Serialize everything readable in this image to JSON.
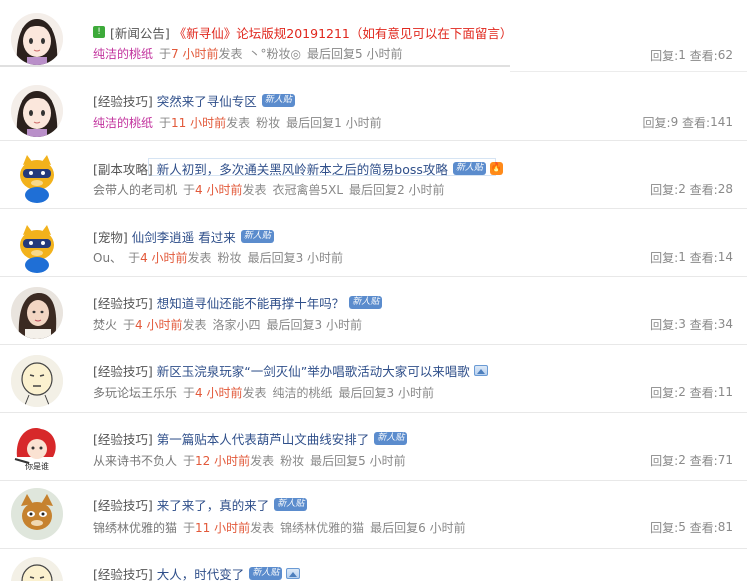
{
  "labels": {
    "prefix": "于",
    "posted": "发表",
    "last_reply": "最后回复",
    "reply": "回复:",
    "view": "查看:"
  },
  "threads": [
    {
      "category": "[新闻公告]",
      "title": "《新寻仙》论坛版规20191211（如有意见可以在下面留言）",
      "author": "纯洁的桃纸",
      "time": "7 小时前",
      "last_replier": "丶°粉妆◎",
      "last_time": "5 小时前",
      "replies": "1",
      "views": "62",
      "avatar": "anime-girl"
    },
    {
      "category": "[经验技巧]",
      "title": "突然来了寻仙专区",
      "badge": "新人贴",
      "author": "纯洁的桃纸",
      "time": "11 小时前",
      "last_replier": "粉妆",
      "last_time": "1 小时前",
      "replies": "9",
      "views": "141",
      "avatar": "anime-girl"
    },
    {
      "category": "[副本攻略]",
      "title": "新人初到，多次通关黑风岭新本之后的简易boss攻略",
      "badge": "新人贴",
      "author": "会带人的老司机",
      "time": "4 小时前",
      "last_replier": "衣冠禽兽5XL",
      "last_time": "2 小时前",
      "replies": "2",
      "views": "28",
      "avatar": "yellow-mascot"
    },
    {
      "category": "[宠物]",
      "title": "仙剑李逍遥 看过来",
      "badge": "新人贴",
      "author": "Ou、",
      "time": "4 小时前",
      "last_replier": "粉妆",
      "last_time": "3 小时前",
      "replies": "1",
      "views": "14",
      "avatar": "yellow-mascot"
    },
    {
      "category": "[经验技巧]",
      "title": "想知道寻仙还能不能再撑十年吗？",
      "badge": "新人贴",
      "author": "焚火",
      "time": "4 小时前",
      "last_replier": "洛家小四",
      "last_time": "3 小时前",
      "replies": "3",
      "views": "34",
      "avatar": "woman-photo"
    },
    {
      "category": "[经验技巧]",
      "title": "新区玉浣泉玩家“一剑灭仙”举办唱歌活动大家可以来唱歌",
      "author": "多玩论坛王乐乐",
      "time": "4 小时前",
      "last_replier": "纯洁的桃纸",
      "last_time": "3 小时前",
      "replies": "2",
      "views": "11",
      "avatar": "smiley-face"
    },
    {
      "category": "[经验技巧]",
      "title": "第一篇贴本人代表葫芦山文曲线安排了",
      "badge": "新人贴",
      "author": "从来诗书不负人",
      "time": "12 小时前",
      "last_replier": "粉妆",
      "last_time": "5 小时前",
      "replies": "2",
      "views": "71",
      "avatar": "red-hair-girl"
    },
    {
      "category": "[经验技巧]",
      "title": "来了来了，真的来了",
      "badge": "新人贴",
      "author": "锦绣林优雅的猫",
      "time": "11 小时前",
      "last_replier": "锦绣林优雅的猫",
      "last_time": "6 小时前",
      "replies": "5",
      "views": "81",
      "avatar": "cartoon-cat"
    },
    {
      "category": "[经验技巧]",
      "title": "大人，时代变了",
      "badge": "新人贴",
      "avatar": "smiley-face"
    }
  ]
}
